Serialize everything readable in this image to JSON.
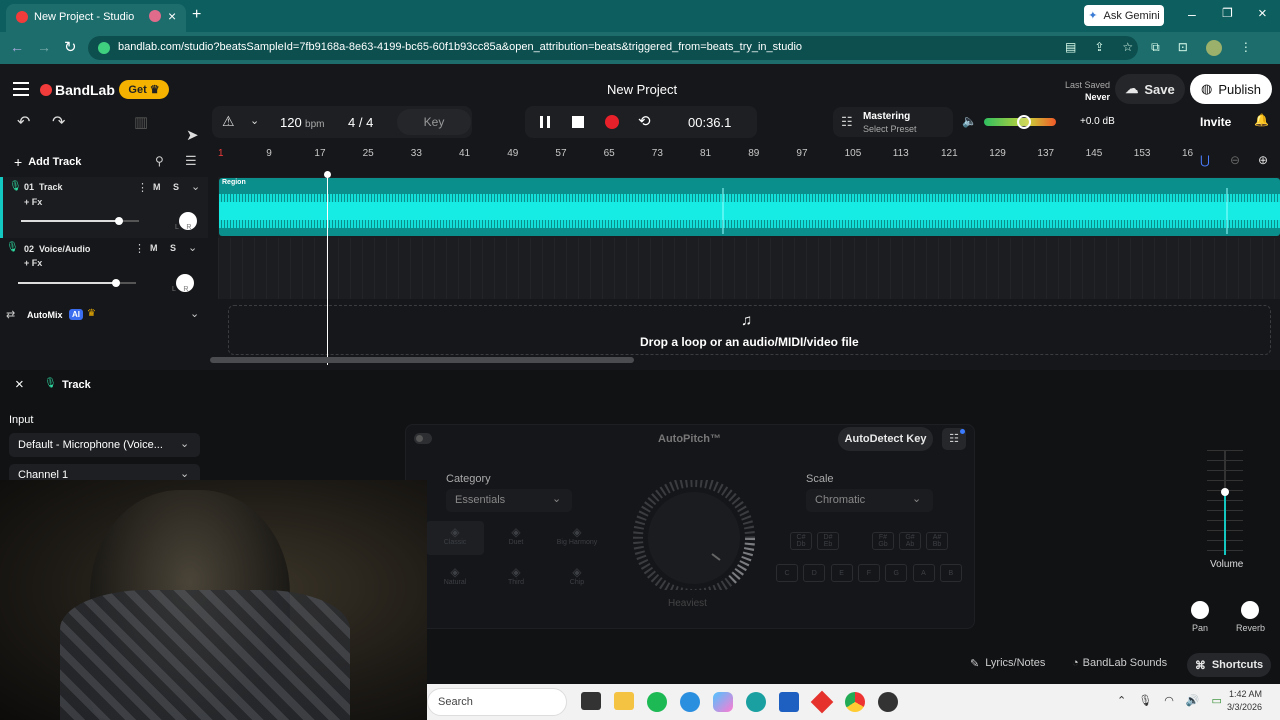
{
  "browser": {
    "tab_title": "New Project - Studio",
    "new_tab": "+",
    "ask_gemini": "Ask Gemini",
    "url": "bandlab.com/studio?beatsSampleId=7fb9168a-8e63-4199-bc65-60f1b93cc85a&open_attribution=beats&triggered_from=beats_try_in_studio"
  },
  "header": {
    "logo": "BandLab",
    "get_label": "Get",
    "project_title": "New Project",
    "last_saved_label": "Last Saved",
    "last_saved_value": "Never",
    "save_label": "Save",
    "publish_label": "Publish"
  },
  "transport": {
    "tempo": "120",
    "tempo_unit": "bpm",
    "time_sig": "4 / 4",
    "key_label": "Key",
    "time": "00:36.1",
    "mastering_label": "Mastering",
    "mastering_sub": "Select Preset",
    "db_readout": "+0.0 dB",
    "invite_label": "Invite",
    "master_volume": 0.55
  },
  "tracks_panel": {
    "add_track": "Add Track",
    "tracks": [
      {
        "name": "01  Track",
        "fx": "+ Fx",
        "mute": "M",
        "solo": "S",
        "lr": "L    R",
        "volume": 0.83
      },
      {
        "name": "02  Voice/Audio",
        "fx": "+ Fx",
        "mute": "M",
        "solo": "S",
        "lr": "L    R",
        "volume": 0.83
      }
    ],
    "automix": "AutoMix",
    "ai_badge": "AI"
  },
  "timeline": {
    "ruler": [
      "1",
      "9",
      "17",
      "25",
      "33",
      "41",
      "49",
      "57",
      "65",
      "73",
      "81",
      "89",
      "97",
      "105",
      "113",
      "121",
      "129",
      "137",
      "145",
      "153",
      "16"
    ],
    "region_label": "Region",
    "drop_text": "Drop a loop or an audio/MIDI/video file"
  },
  "editor": {
    "track_title": "Track",
    "input_label": "Input",
    "input_value": "Default - Microphone (Voice...",
    "channel_value": "Channel 1",
    "autopitch_title": "AutoPitch™",
    "autodetect_label": "AutoDetect Key",
    "category_label": "Category",
    "category_value": "Essentials",
    "scale_label": "Scale",
    "scale_value": "Chromatic",
    "presets": [
      "Classic",
      "Duet",
      "Big Harmony",
      "Natural",
      "Third",
      "Chip"
    ],
    "knob_label": "Heaviest",
    "sharp_keys": [
      "C#\nDb",
      "D#\nEb",
      "F#\nGb",
      "G#\nAb",
      "A#\nBb"
    ],
    "natural_keys": [
      "C",
      "D",
      "E",
      "F",
      "G",
      "A",
      "B"
    ],
    "volume_label": "Volume",
    "volume_level": 0.6,
    "pan_label": "Pan",
    "reverb_label": "Reverb"
  },
  "footer": {
    "lyrics": "Lyrics/Notes",
    "sounds": "BandLab Sounds",
    "shortcuts": "Shortcuts"
  },
  "taskbar": {
    "search": "Search",
    "time": "1:42 AM",
    "date": "3/3/2026"
  },
  "colors": {
    "accent": "#0fd6d0",
    "brand_red": "#f23b3b",
    "get_yellow": "#f5b300"
  }
}
